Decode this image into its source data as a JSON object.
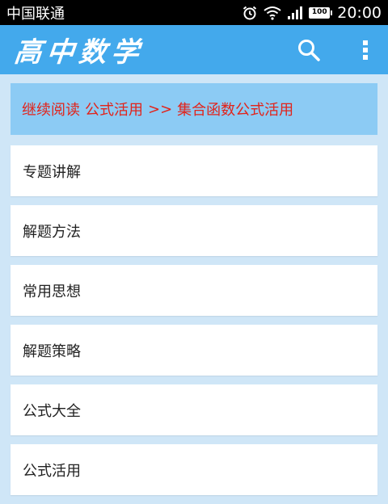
{
  "status_bar": {
    "carrier": "中国联通",
    "battery": "100",
    "time": "20:00",
    "icons": [
      "alarm-icon",
      "wifi-icon",
      "signal-icon",
      "battery-icon"
    ]
  },
  "app_bar": {
    "title": "高中数学",
    "background_color": "#43a9ec",
    "actions": [
      "search-icon",
      "more-vert-icon"
    ]
  },
  "continue_reading": {
    "prefix": "继续阅读",
    "category": "公式活用",
    "separator": ">>",
    "item": "集合函数公式活用",
    "text_color": "#e2231a"
  },
  "menu": {
    "items": [
      {
        "label": "专题讲解"
      },
      {
        "label": "解题方法"
      },
      {
        "label": "常用思想"
      },
      {
        "label": "解题策略"
      },
      {
        "label": "公式大全"
      },
      {
        "label": "公式活用"
      }
    ]
  }
}
